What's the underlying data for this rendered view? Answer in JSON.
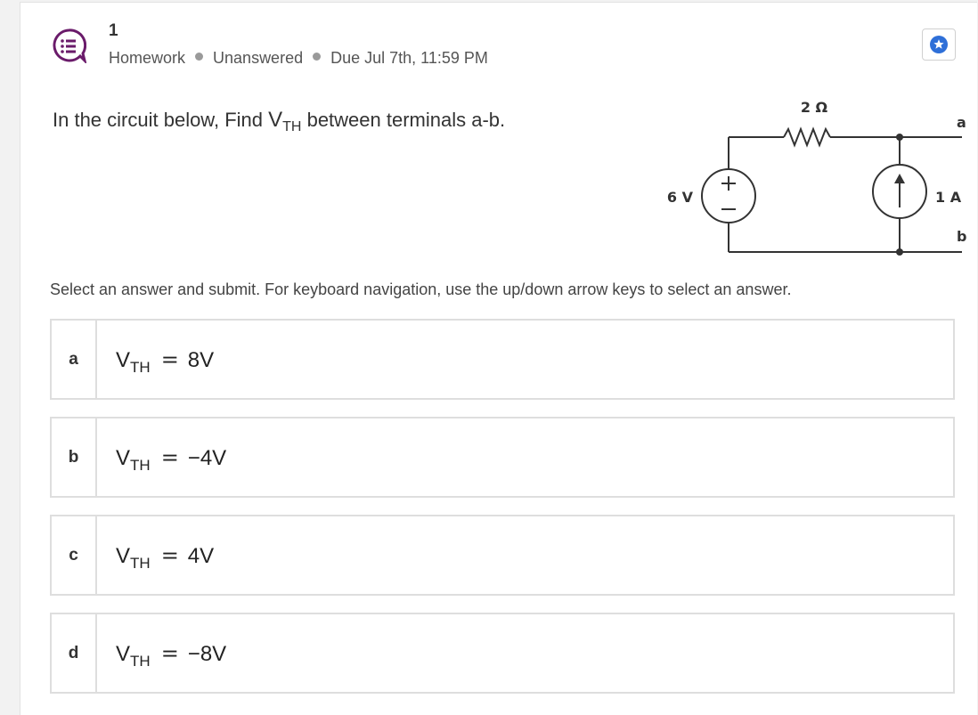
{
  "question": {
    "number": "1",
    "type": "Homework",
    "status": "Unanswered",
    "due": "Due Jul 7th, 11:59 PM",
    "prompt_before": "In the circuit below, Find ",
    "prompt_var": "V",
    "prompt_sub": "TH",
    "prompt_after": " between terminals a-b."
  },
  "circuit": {
    "resistor_label": "2 Ω",
    "voltage_label": "6 V",
    "current_label": "1 A",
    "terminal_a": "a",
    "terminal_b": "b"
  },
  "instructions": "Select an answer and submit. For keyboard navigation, use the up/down arrow keys to select an answer.",
  "options": [
    {
      "letter": "a",
      "var": "V",
      "sub": "TH",
      "eq": "=",
      "value": "8V"
    },
    {
      "letter": "b",
      "var": "V",
      "sub": "TH",
      "eq": "=",
      "value": "−4V"
    },
    {
      "letter": "c",
      "var": "V",
      "sub": "TH",
      "eq": "=",
      "value": "4V"
    },
    {
      "letter": "d",
      "var": "V",
      "sub": "TH",
      "eq": "=",
      "value": "−8V"
    }
  ],
  "colors": {
    "accent_purple": "#6a1b6a",
    "star_blue": "#2e6fd8"
  },
  "icons": {
    "question_type": "multiple-choice-list-icon",
    "bookmark": "star-icon"
  }
}
